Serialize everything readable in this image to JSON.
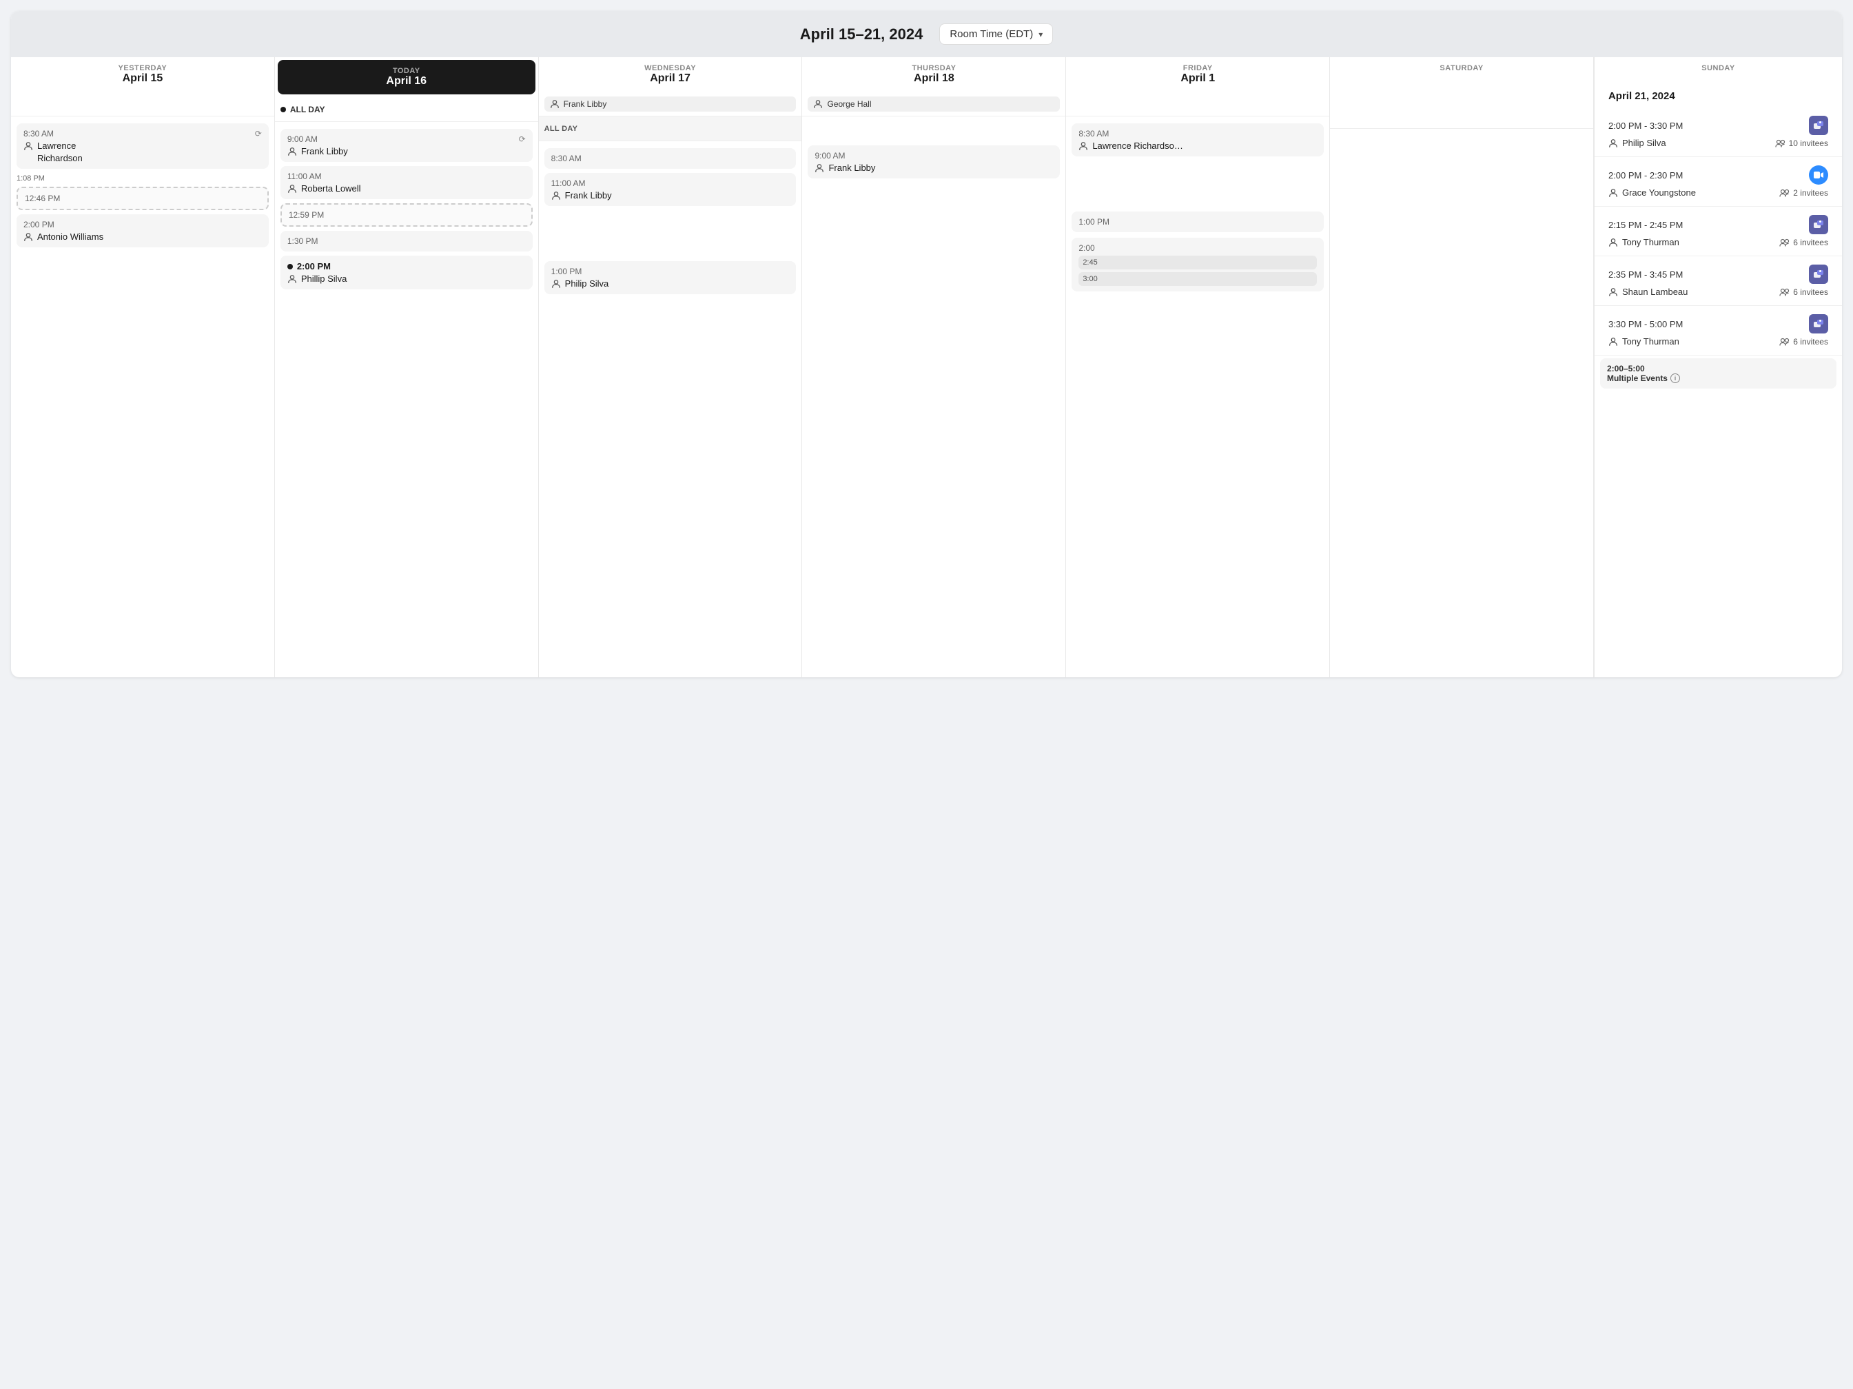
{
  "header": {
    "title": "April 15–21, 2024",
    "timezone_label": "Room Time (EDT)"
  },
  "days": [
    {
      "id": "yesterday",
      "label": "YESTERDAY",
      "date": "April 15",
      "is_today": false,
      "allday": null,
      "events": [
        {
          "time": "8:30 AM",
          "person": "Lawrence Richardson",
          "repeat": true,
          "bold": false,
          "dashed": false
        },
        {
          "time": "12:46 PM",
          "person": null,
          "repeat": false,
          "bold": false,
          "dashed": true
        },
        {
          "time": "2:00 PM",
          "person": "Antonio Williams",
          "repeat": false,
          "bold": false,
          "dashed": false
        }
      ],
      "current_time": "1:08 PM"
    },
    {
      "id": "today",
      "label": "TODAY",
      "date": "April 16",
      "is_today": true,
      "allday": {
        "label": "ALL DAY",
        "has_dot": true
      },
      "events": [
        {
          "time": "9:00 AM",
          "person": "Frank Libby",
          "repeat": true,
          "bold": false,
          "dashed": false
        },
        {
          "time": "11:00 AM",
          "person": "Roberta Lowell",
          "repeat": false,
          "bold": false,
          "dashed": false
        },
        {
          "time": "12:59 PM",
          "person": null,
          "repeat": false,
          "bold": false,
          "dashed": true
        },
        {
          "time": "1:30 PM",
          "person": null,
          "repeat": false,
          "bold": false,
          "dashed": false
        },
        {
          "time": "2:00 PM",
          "person": "Phillip Silva",
          "repeat": false,
          "bold": true,
          "dashed": false,
          "dot": true
        }
      ]
    },
    {
      "id": "wednesday",
      "label": "WEDNESDAY",
      "date": "April 17",
      "is_today": false,
      "allday": {
        "label": "ALL DAY",
        "has_dot": false
      },
      "events": [
        {
          "time": "8:30 AM",
          "person": null,
          "repeat": false,
          "bold": false,
          "dashed": false
        },
        {
          "time": "11:00 AM",
          "person": "Frank Libby",
          "repeat": false,
          "bold": false,
          "dashed": false
        },
        {
          "time": "1:00 PM",
          "person": "Philip Silva",
          "repeat": false,
          "bold": false,
          "dashed": false
        }
      ]
    },
    {
      "id": "thursday",
      "label": "THURSDAY",
      "date": "April 18",
      "is_today": false,
      "allday": null,
      "events": [
        {
          "time": "9:00 AM",
          "person": "Frank Libby",
          "repeat": false,
          "bold": false,
          "dashed": false
        }
      ]
    },
    {
      "id": "friday",
      "label": "FRIDAY",
      "date": "April 1",
      "is_today": false,
      "allday": null,
      "events": [
        {
          "time": "8:30 AM",
          "person": "Lawrence Richardso…",
          "repeat": false,
          "bold": false,
          "dashed": false
        },
        {
          "time": "1:00 PM",
          "person": null,
          "repeat": false,
          "bold": false,
          "dashed": false
        },
        {
          "time": "2:00",
          "sub": "2:45",
          "sub2": "3:00",
          "person": null,
          "repeat": false,
          "bold": false,
          "dashed": false
        }
      ]
    }
  ],
  "right_panel": {
    "date": "April 21, 2024",
    "events": [
      {
        "time": "2:00 PM - 3:30 PM",
        "person": "Philip Silva",
        "invitees": "10 invitees",
        "platform": "teams"
      },
      {
        "time": "2:00 PM - 2:30 PM",
        "person": "Grace Youngstone",
        "invitees": "2 invitees",
        "platform": "zoom"
      },
      {
        "time": "2:15 PM - 2:45 PM",
        "person": "Tony Thurman",
        "invitees": "6 invitees",
        "platform": "teams"
      },
      {
        "time": "2:35 PM - 3:45 PM",
        "person": "Shaun Lambeau",
        "invitees": "6 invitees",
        "platform": "teams"
      },
      {
        "time": "3:30 PM - 5:00 PM",
        "person": "Tony Thurman",
        "invitees": "6 invitees",
        "platform": "teams"
      }
    ],
    "multiple_events": {
      "time": "2:00–5:00",
      "label": "Multiple Events"
    }
  },
  "saturday": {
    "label": "SATURDAY",
    "date": ""
  },
  "sunday": {
    "label": "SUNDAY",
    "date": ""
  },
  "allday_events": {
    "wednesday_person": "Frank Libby",
    "thursday_person": "George Hall"
  }
}
